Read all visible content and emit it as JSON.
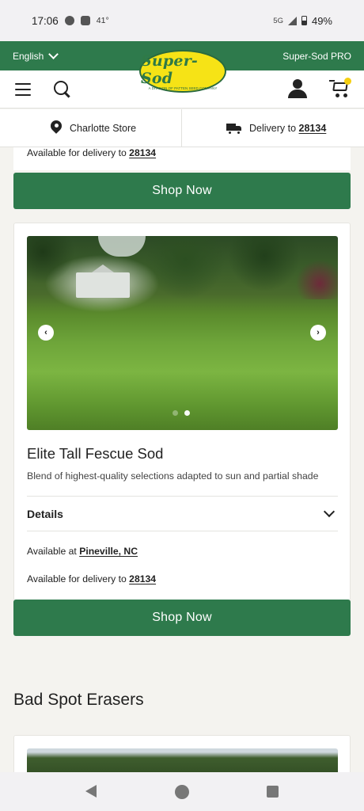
{
  "status_bar": {
    "time": "17:06",
    "temperature": "41°",
    "network": "5G",
    "battery": "49%"
  },
  "top_bar": {
    "language": "English",
    "pro_link": "Super-Sod PRO"
  },
  "logo": {
    "text": "Super-Sod",
    "tagline": "A DIVISION OF PATTEN SEED COMPANY"
  },
  "nav": {
    "icons": [
      "menu-icon",
      "search-icon",
      "account-icon",
      "cart-icon"
    ],
    "cart_badge_color": "#f5cf10"
  },
  "store_bar": {
    "store_label": "Charlotte Store",
    "delivery_prefix": "Delivery to",
    "delivery_zip": "28134"
  },
  "previous_card": {
    "delivery_prefix": "Available for delivery to",
    "delivery_zip": "28134",
    "button": "Shop Now"
  },
  "product_card": {
    "title": "Elite Tall Fescue Sod",
    "description": "Blend of highest-quality selections adapted to sun and partial shade",
    "details_label": "Details",
    "available_at_prefix": "Available at",
    "available_at_location": "Pineville, NC",
    "delivery_prefix": "Available for delivery to",
    "delivery_zip": "28134",
    "button": "Shop Now",
    "carousel_current_slide": 2,
    "carousel_slides": 2
  },
  "next_section": {
    "title": "Bad Spot Erasers"
  },
  "colors": {
    "brand_green": "#2e7a4c",
    "logo_yellow": "#f6e316",
    "page_background": "#f4f3ef"
  }
}
